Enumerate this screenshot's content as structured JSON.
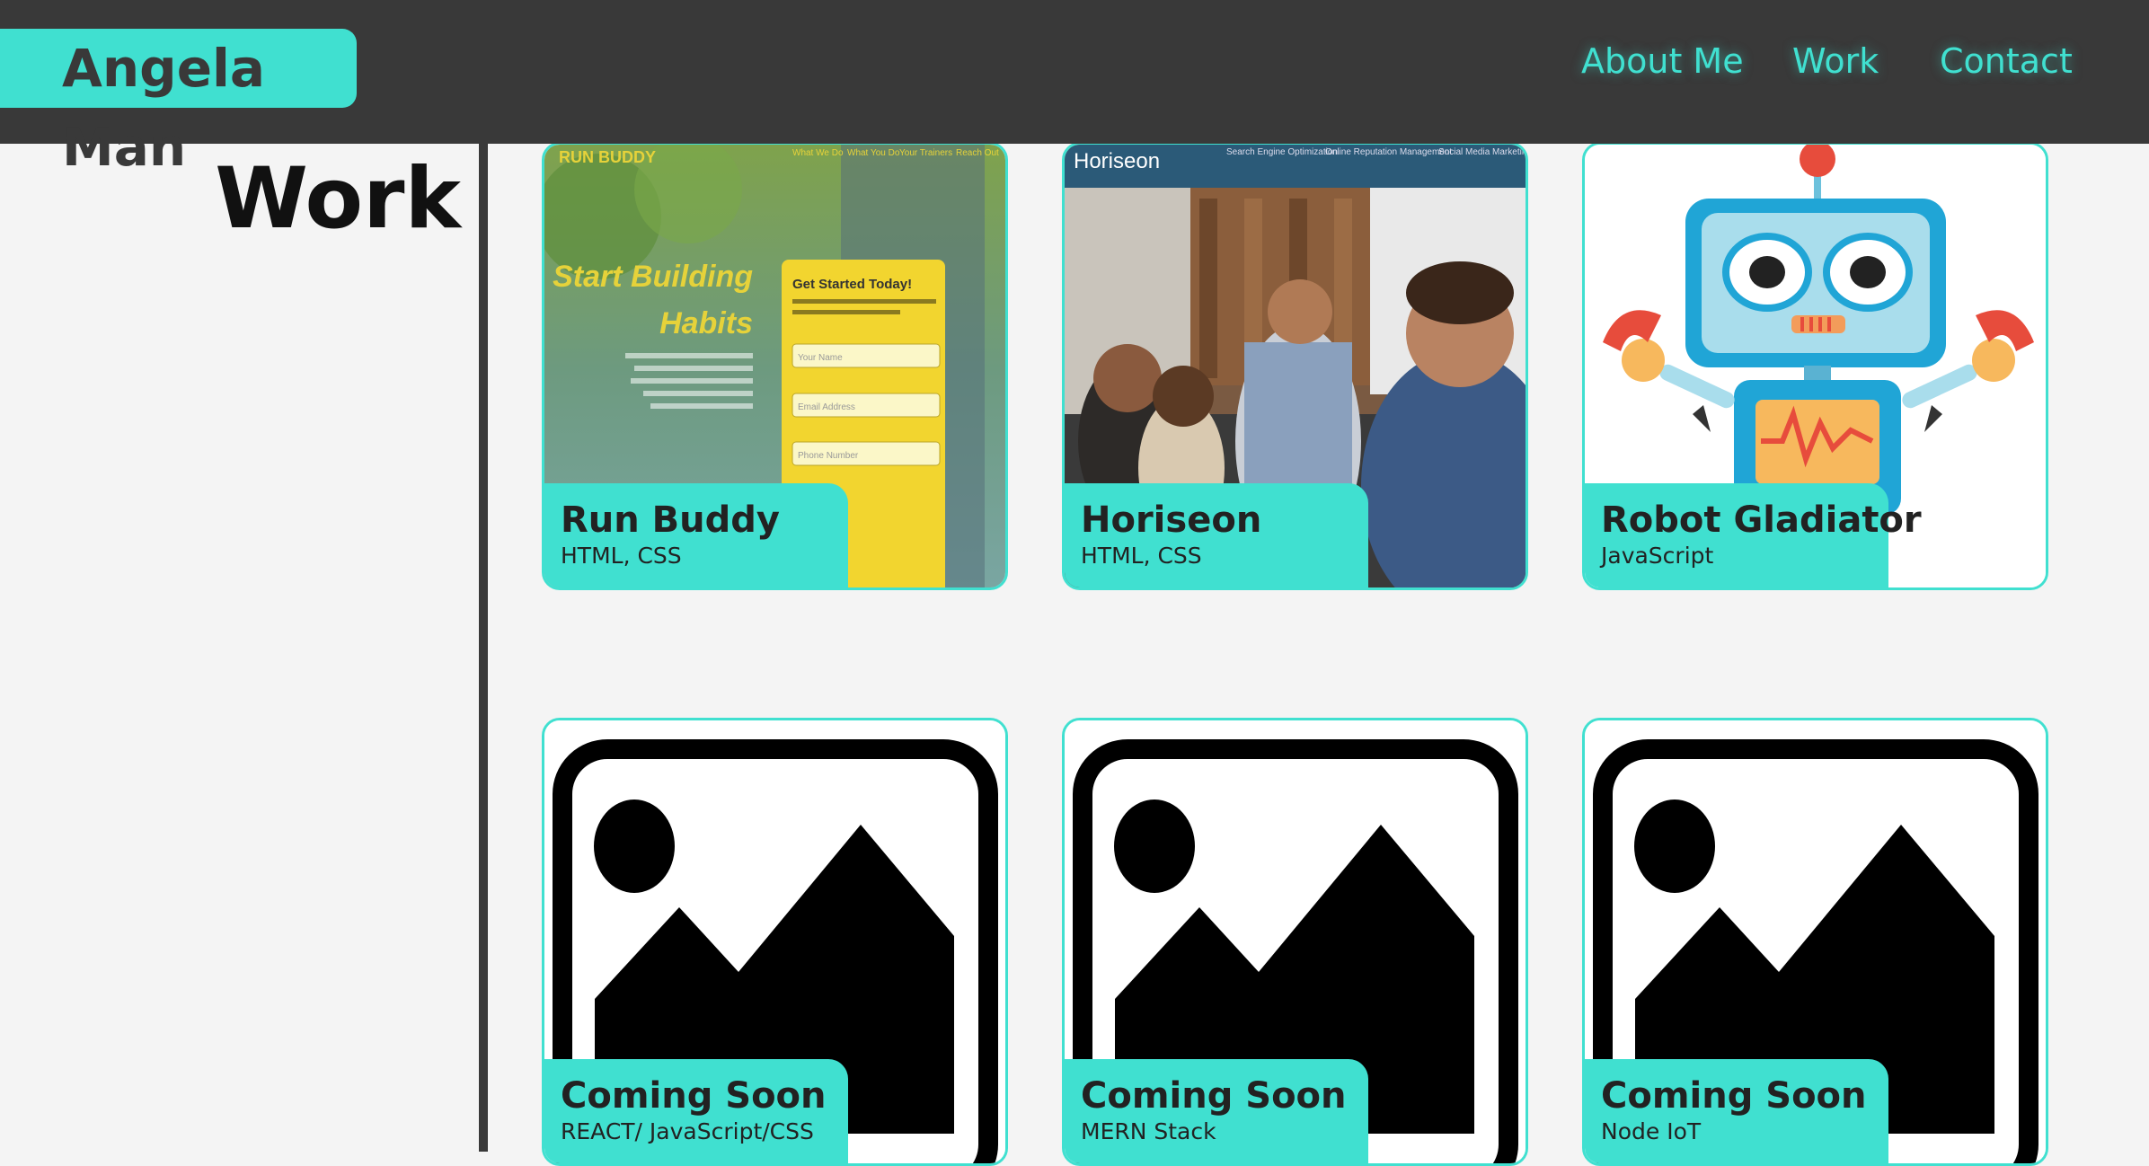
{
  "header": {
    "brand": "Angela Man",
    "nav": [
      {
        "label": "About Me"
      },
      {
        "label": "Work"
      },
      {
        "label": "Contact"
      }
    ]
  },
  "main": {
    "section_title": "Work",
    "projects": [
      {
        "title": "Run Buddy",
        "tech": "HTML, CSS",
        "image": "run-buddy-screenshot",
        "preview": {
          "logo": "RUN BUDDY",
          "nav": [
            "What We Do",
            "What You Do",
            "Your Trainers",
            "Reach Out"
          ],
          "headline1": "Start Building",
          "headline2": "Habits",
          "form_title": "Get Started Today!",
          "field1": "Your Name",
          "field2": "Email Address",
          "field3": "Phone Number"
        }
      },
      {
        "title": "Horiseon",
        "tech": "HTML, CSS",
        "image": "horiseon-screenshot",
        "preview": {
          "logo": "Horiseon",
          "nav": [
            "Search Engine Optimization",
            "Online Reputation Management",
            "Social Media Marketing"
          ]
        }
      },
      {
        "title": "Robot Gladiator",
        "tech": "JavaScript",
        "image": "robot-illustration"
      },
      {
        "title": "Coming Soon",
        "tech": "REACT/ JavaScript/CSS",
        "image": "placeholder-image-icon"
      },
      {
        "title": "Coming Soon",
        "tech": "MERN Stack",
        "image": "placeholder-image-icon"
      },
      {
        "title": "Coming Soon",
        "tech": "Node IoT",
        "image": "placeholder-image-icon"
      }
    ]
  },
  "colors": {
    "accent": "#40e0d0",
    "header_bg": "#393939",
    "page_bg": "#f4f4f4"
  }
}
